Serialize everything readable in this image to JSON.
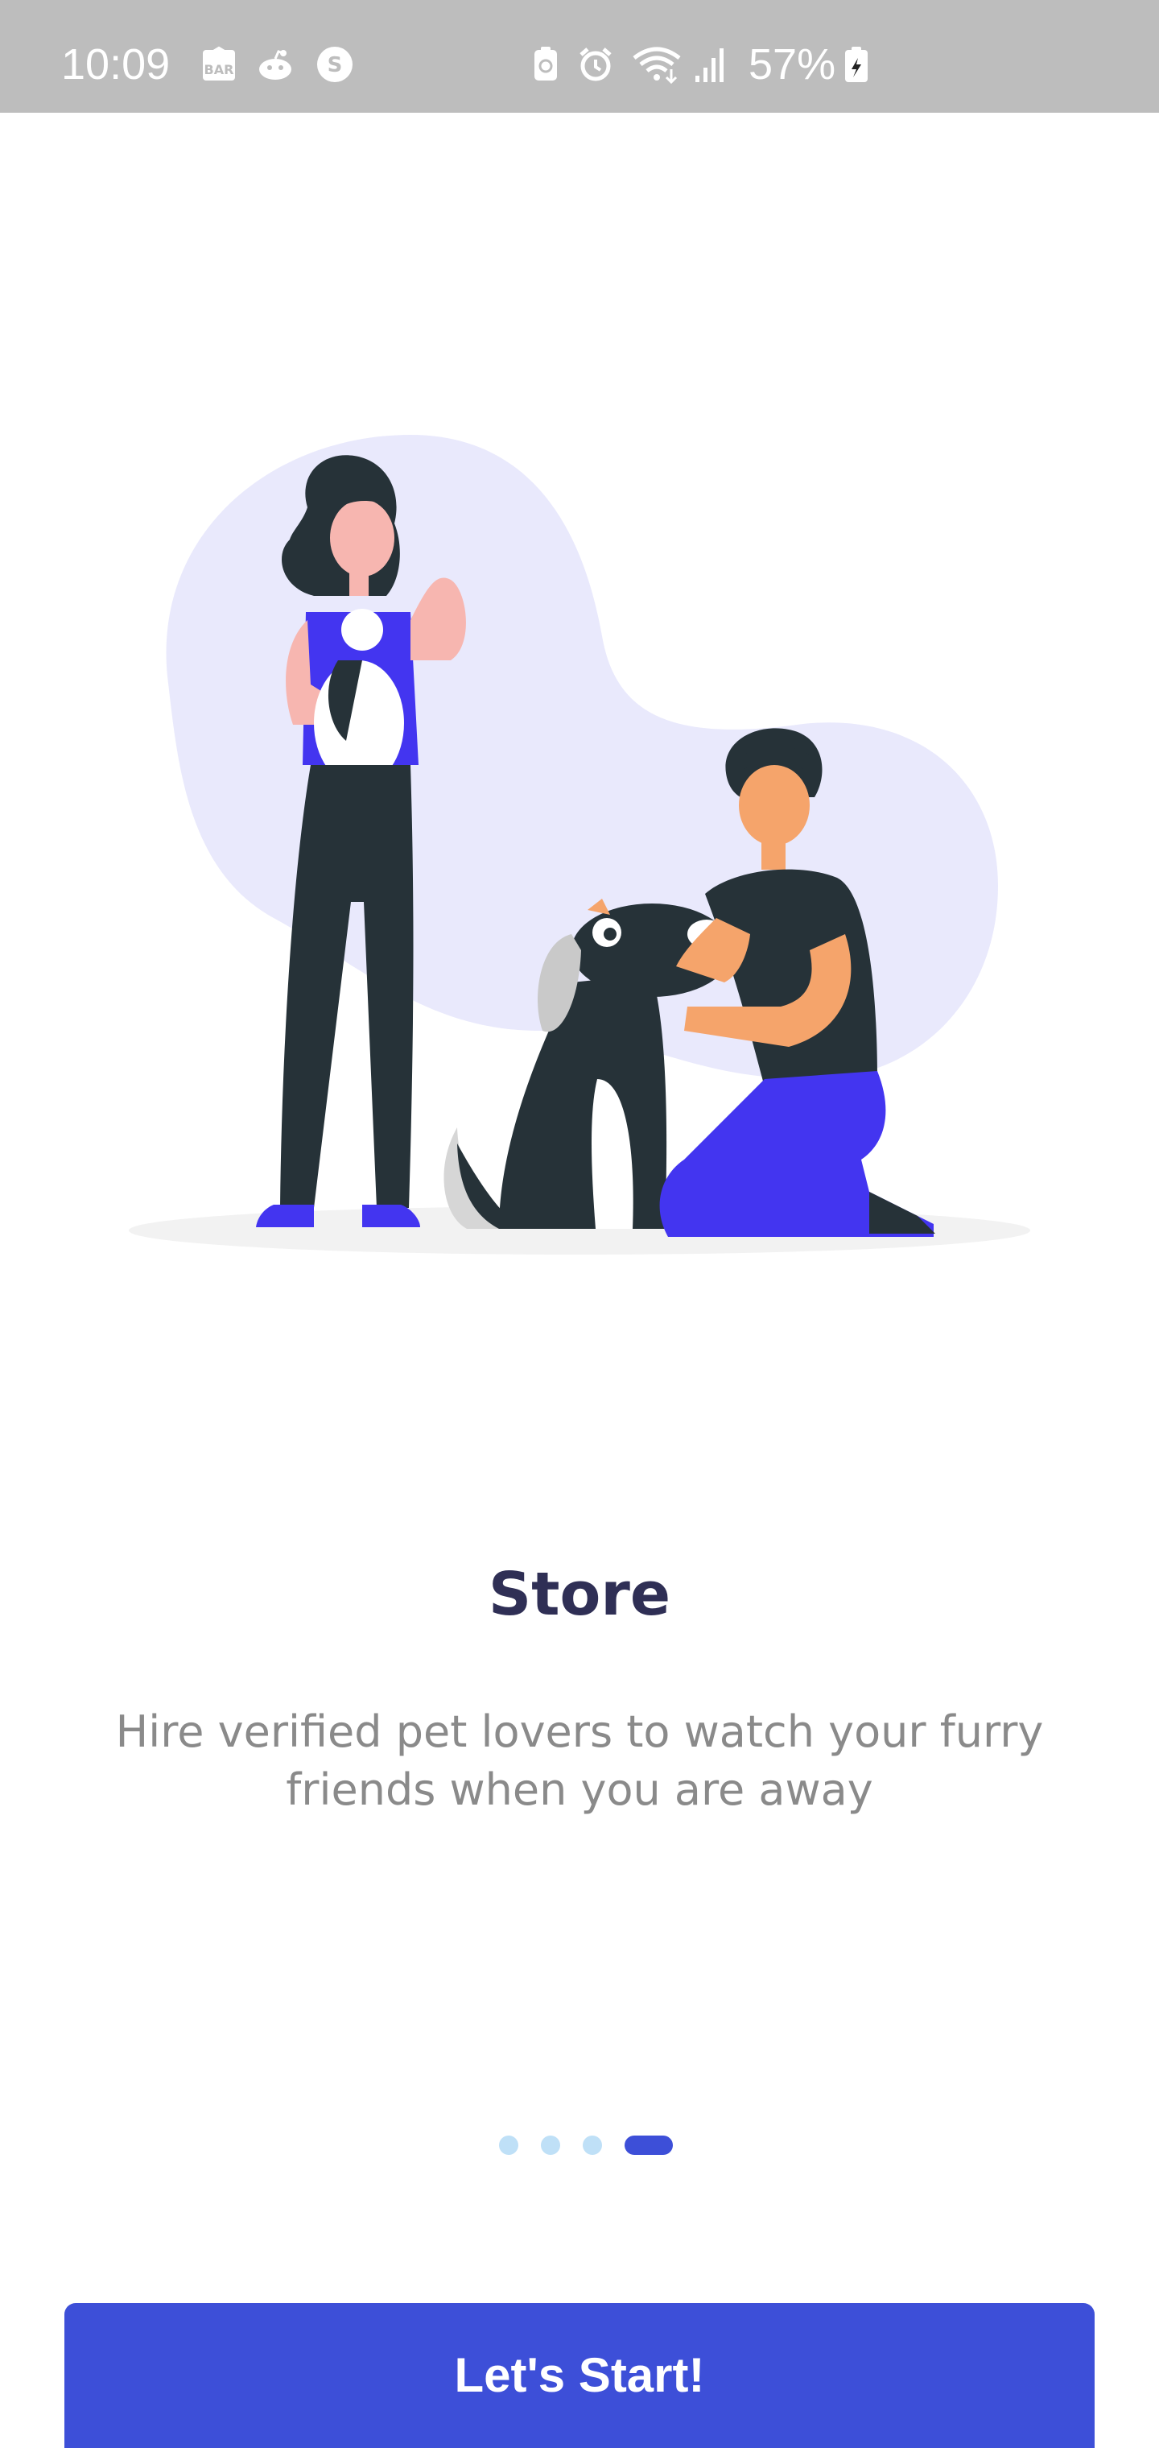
{
  "status_bar": {
    "time": "10:09",
    "battery_percent": "57%",
    "icons": [
      "bar-app-icon",
      "reddit-icon",
      "s-app-icon",
      "battery-saver-icon",
      "alarm-icon",
      "wifi-icon",
      "signal-icon",
      "battery-icon"
    ]
  },
  "illustration": {
    "icon": "pet-sitters-illustration",
    "colors": {
      "blob": "#e9e9fc",
      "accent": "#4335f0",
      "dark": "#263238",
      "skin": "#f5a46b",
      "pink_skin": "#f7b6b0"
    }
  },
  "content": {
    "title": "Store",
    "subtitle": "Hire verified pet lovers to watch your furry friends when you are away"
  },
  "pager": {
    "count": 4,
    "active_index": 3
  },
  "cta": {
    "label": "Let's Start!"
  },
  "colors": {
    "primary": "#3d4fd8",
    "dot_inactive": "#bfe0f7",
    "title": "#2f2f55",
    "subtitle": "#8a8a8a"
  }
}
